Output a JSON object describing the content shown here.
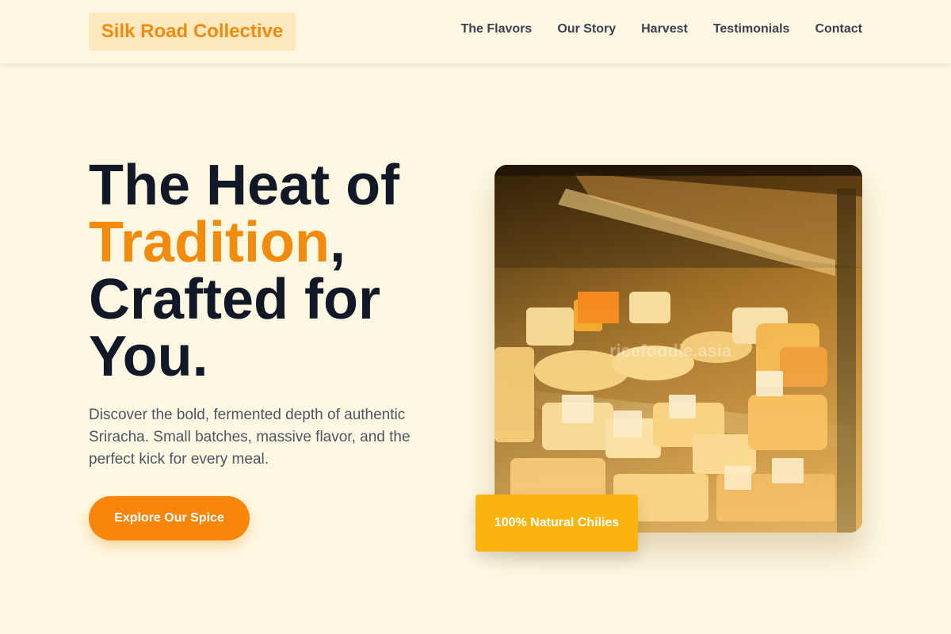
{
  "brand": {
    "name": "Silk Road Collective"
  },
  "nav": {
    "items": [
      {
        "label": "The Flavors"
      },
      {
        "label": "Our Story"
      },
      {
        "label": "Harvest"
      },
      {
        "label": "Testimonials"
      },
      {
        "label": "Contact"
      }
    ]
  },
  "hero": {
    "title_line1": "The Heat of",
    "title_accent": "Tradition",
    "title_comma": ",",
    "title_line3": "Crafted for",
    "title_line4": "You.",
    "description": "Discover the bold, fermented depth of authentic Sriracha. Small batches, massive flavor, and the perfect kick for every meal.",
    "cta_label": "Explore Our Spice",
    "badge_label": "100% Natural Chilies",
    "image_watermark": "ricefoodie.asia"
  },
  "colors": {
    "background": "#fef8e2",
    "accent": "#f28a0c",
    "cta": "#f9850b",
    "badge": "#fbb40e",
    "logo_bg": "#fde8bf",
    "heading": "#111827",
    "body_text": "#4b5563"
  }
}
